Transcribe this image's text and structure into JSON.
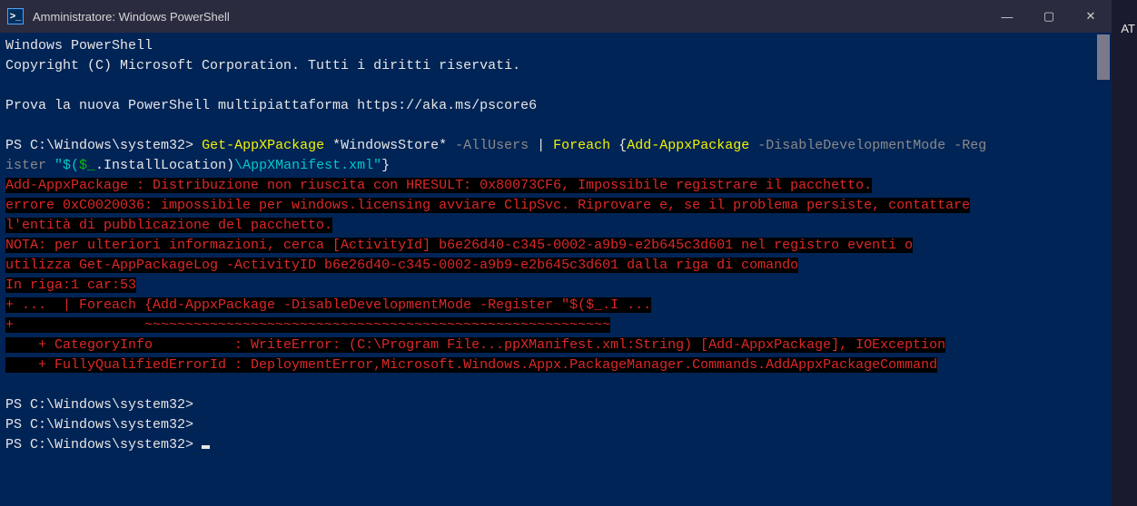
{
  "edge_fragment": "AT",
  "titlebar": {
    "icon_glyph": ">_",
    "title": "Amministratore: Windows PowerShell",
    "minimize": "—",
    "maximize": "▢",
    "close": "✕"
  },
  "header": {
    "line1": "Windows PowerShell",
    "line2": "Copyright (C) Microsoft Corporation. Tutti i diritti riservati.",
    "tip": "Prova la nuova PowerShell multipiattaforma https://aka.ms/pscore6"
  },
  "prompt": "PS C:\\Windows\\system32>",
  "cmd": {
    "p1": "Get-AppXPackage",
    "p2": " *WindowsStore* ",
    "p3": "-AllUsers",
    "p4": " | ",
    "p5": "Foreach",
    "p6": " {",
    "p7": "Add-AppxPackage",
    "p8": " -DisableDevelopmentMode -Reg",
    "line2pre": "ister ",
    "line2str1": "\"$(",
    "line2var": "$_",
    "line2str2": ".InstallLocation)",
    "line2path": "\\AppXManifest.xml\"",
    "line2end": "}"
  },
  "error": {
    "l1": "Add-AppxPackage : Distribuzione non riuscita con HRESULT: 0x80073CF6, Impossibile registrare il pacchetto.",
    "l2": "errore 0xC0020036: impossibile per windows.licensing avviare ClipSvc. Riprovare e, se il problema persiste, contattare",
    "l3": "l'entità di pubblicazione del pacchetto.",
    "l4": "NOTA: per ulteriori informazioni, cerca [ActivityId] b6e26d40-c345-0002-a9b9-e2b645c3d601 nel registro eventi o",
    "l5": "utilizza Get-AppPackageLog -ActivityID b6e26d40-c345-0002-a9b9-e2b645c3d601 dalla riga di comando",
    "l6": "In riga:1 car:53",
    "l7": "+ ...  | Foreach {Add-AppxPackage -DisableDevelopmentMode -Register \"$($_.I ...",
    "l8": "+                ~~~~~~~~~~~~~~~~~~~~~~~~~~~~~~~~~~~~~~~~~~~~~~~~~~~~~~~~~",
    "l9": "    + CategoryInfo          : WriteError: (C:\\Program File...ppXManifest.xml:String) [Add-AppxPackage], IOException",
    "l10": "    + FullyQualifiedErrorId : DeploymentError,Microsoft.Windows.Appx.PackageManager.Commands.AddAppxPackageCommand"
  }
}
